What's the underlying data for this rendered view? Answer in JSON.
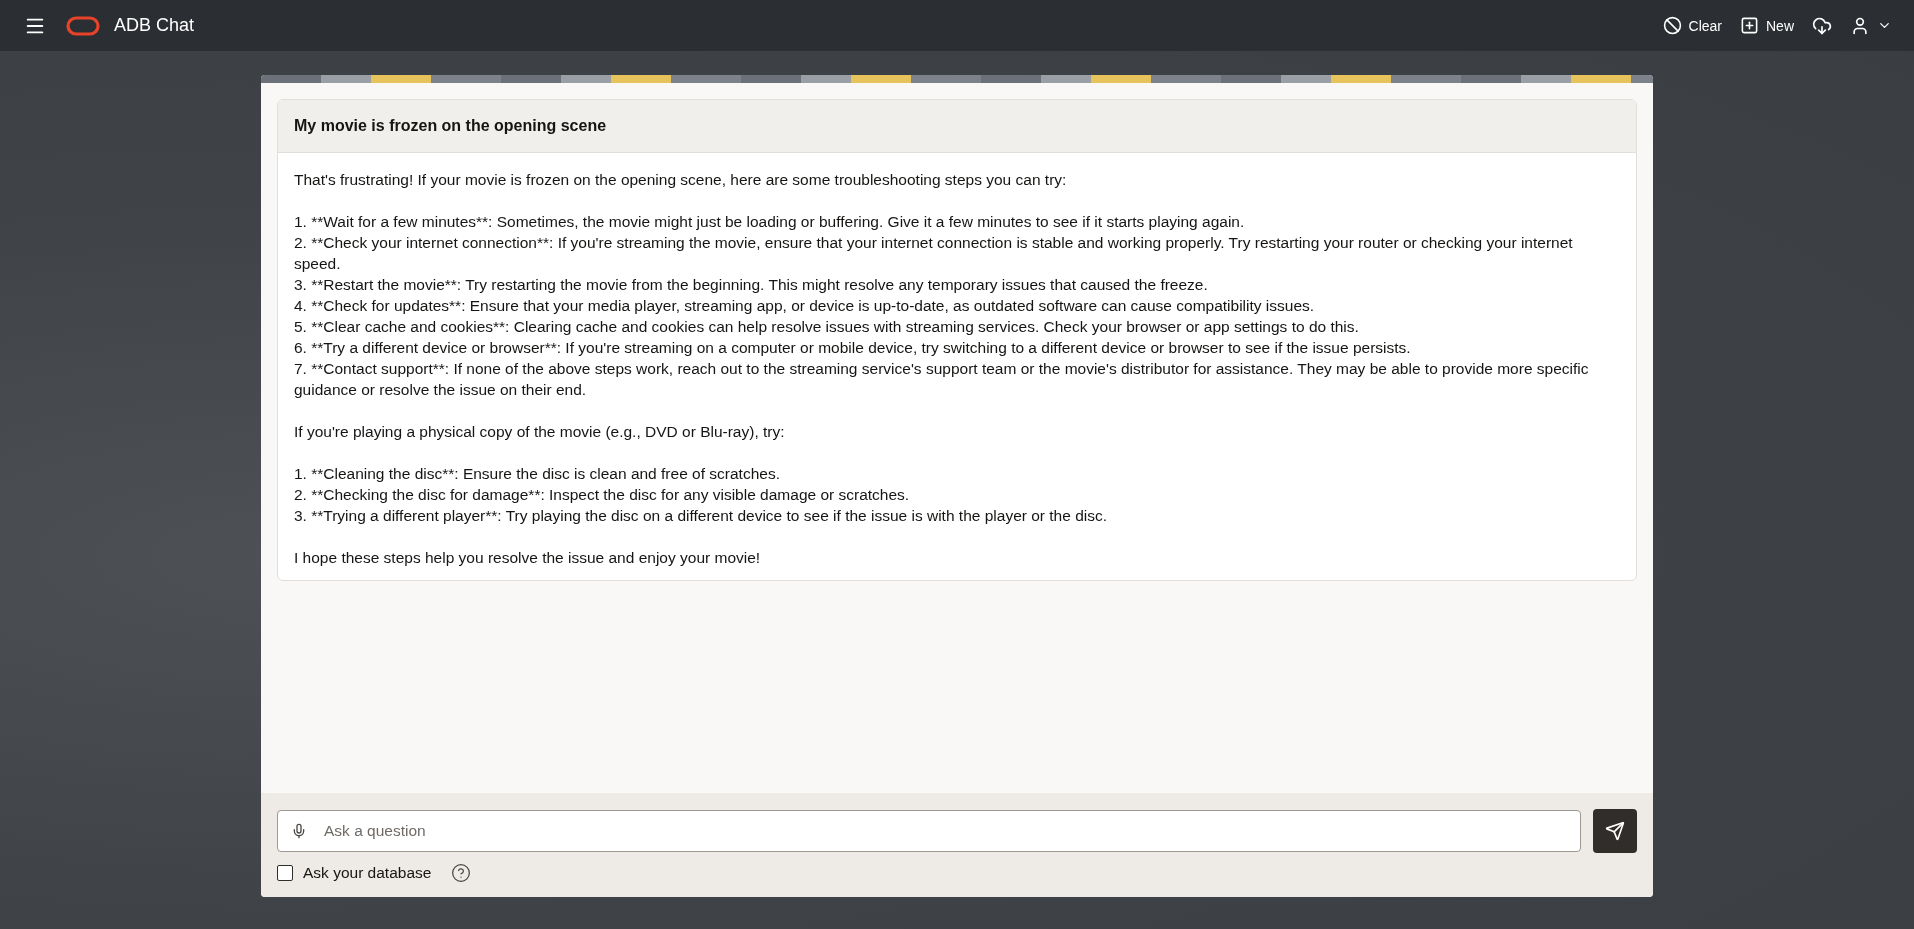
{
  "header": {
    "title": "ADB Chat",
    "actions": [
      {
        "kind": "clear",
        "label": "Clear"
      },
      {
        "kind": "new",
        "label": "New"
      },
      {
        "kind": "download"
      },
      {
        "kind": "user"
      }
    ]
  },
  "conversation": {
    "question": "My movie is frozen on the opening scene",
    "answer": [
      [
        "That's frustrating! If your movie is frozen on the opening scene, here are some troubleshooting steps you can try:"
      ],
      [
        "1. **Wait for a few minutes**: Sometimes, the movie might just be loading or buffering. Give it a few minutes to see if it starts playing again.",
        "2. **Check your internet connection**: If you're streaming the movie, ensure that your internet connection is stable and working properly. Try restarting your router or checking your internet speed.",
        "3. **Restart the movie**: Try restarting the movie from the beginning. This might resolve any temporary issues that caused the freeze.",
        "4. **Check for updates**: Ensure that your media player, streaming app, or device is up-to-date, as outdated software can cause compatibility issues.",
        "5. **Clear cache and cookies**: Clearing cache and cookies can help resolve issues with streaming services. Check your browser or app settings to do this.",
        "6. **Try a different device or browser**: If you're streaming on a computer or mobile device, try switching to a different device or browser to see if the issue persists.",
        "7. **Contact support**: If none of the above steps work, reach out to the streaming service's support team or the movie's distributor for assistance. They may be able to provide more specific guidance or resolve the issue on their end."
      ],
      [
        "If you're playing a physical copy of the movie (e.g., DVD or Blu-ray), try:"
      ],
      [
        "1. **Cleaning the disc**: Ensure the disc is clean and free of scratches.",
        "2. **Checking the disc for damage**: Inspect the disc for any visible damage or scratches.",
        "3. **Trying a different player**: Try playing the disc on a different device to see if the issue is with the player or the disc."
      ],
      [
        "I hope these steps help you resolve the issue and enjoy your movie!"
      ]
    ]
  },
  "composer": {
    "placeholder": "Ask a question",
    "ask_database": {
      "label": "Ask your database",
      "checked": false
    }
  }
}
